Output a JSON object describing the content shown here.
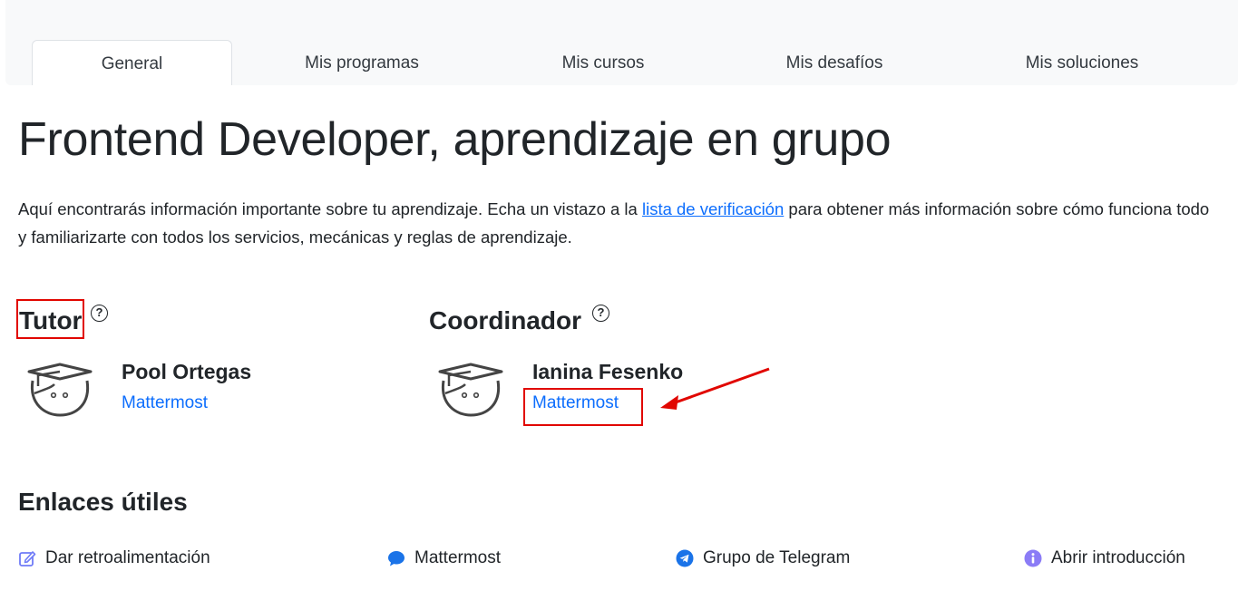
{
  "tabs": [
    {
      "label": "General",
      "active": true
    },
    {
      "label": "Mis programas",
      "active": false
    },
    {
      "label": "Mis cursos",
      "active": false
    },
    {
      "label": "Mis desafíos",
      "active": false
    },
    {
      "label": "Mis soluciones",
      "active": false
    }
  ],
  "page_title": "Frontend Developer, aprendizaje en grupo",
  "intro": {
    "before": "Aquí encontrarás información importante sobre tu aprendizaje. Echa un vistazo a la ",
    "link": "lista de verificación",
    "after": " para obtener más información sobre cómo funciona todo y familiarizarte con todos los servicios, mecánicas y reglas de aprendizaje."
  },
  "tutor": {
    "heading": "Tutor",
    "help": "?",
    "name": "Pool Ortegas",
    "link": "Mattermost"
  },
  "coordinator": {
    "heading": "Coordinador",
    "help": "?",
    "name": "Ianina Fesenko",
    "link": "Mattermost"
  },
  "useful_links": {
    "heading": "Enlaces útiles",
    "items": [
      {
        "label": "Dar retroalimentación",
        "icon": "edit-icon"
      },
      {
        "label": "Mattermost",
        "icon": "chat-bubble-icon"
      },
      {
        "label": "Grupo de Telegram",
        "icon": "telegram-icon"
      },
      {
        "label": "Abrir introducción",
        "icon": "info-icon"
      }
    ]
  },
  "colors": {
    "link": "#0d6efd",
    "annotation": "#e10600",
    "info_icon": "#8b7cf6"
  }
}
